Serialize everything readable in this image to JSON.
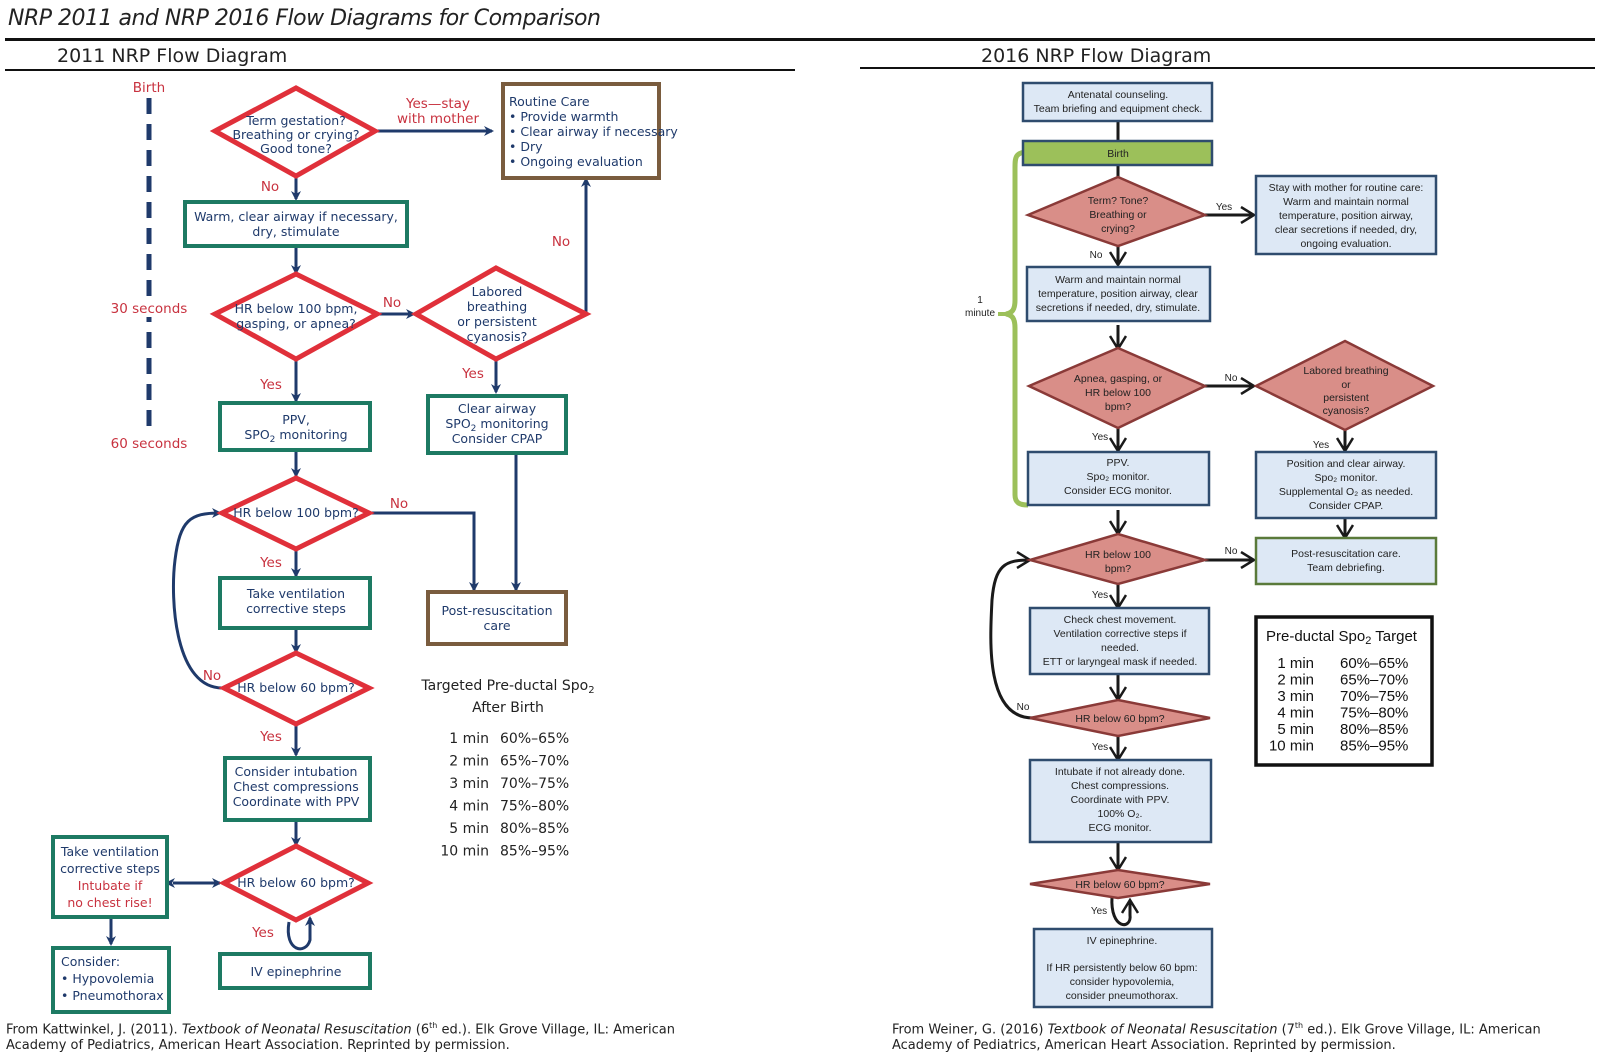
{
  "page": {
    "title": "NRP 2011 and NRP 2016 Flow Diagrams for Comparison"
  },
  "colors": {
    "navy": "#1f3a6b",
    "red": "#e0303a",
    "teal": "#1d7a63",
    "brown": "#7a5c3e",
    "pink": "#d98e88",
    "lightblue": "#dde8f5",
    "green": "#9cc05a",
    "darkline": "#1a1a1a"
  },
  "diagram2011": {
    "title": "2011 NRP Flow Diagram",
    "timeline": {
      "birth": "Birth",
      "t30": "30 seconds",
      "t60": "60 seconds"
    },
    "d_term": [
      "Term gestation?",
      "Breathing or crying?",
      "Good tone?"
    ],
    "yes_stay": [
      "Yes—stay",
      "with mother"
    ],
    "routine": [
      "Routine Care",
      "• Provide warmth",
      "• Clear airway if necessary",
      "• Dry",
      "• Ongoing evaluation"
    ],
    "no": "No",
    "yes": "Yes",
    "warm": [
      "Warm, clear airway if necessary,",
      "dry, stimulate"
    ],
    "d_hr100_gasp": [
      "HR below 100 bpm,",
      "gasping, or apnea?"
    ],
    "d_labored": [
      "Labored",
      "breathing",
      "or persistent",
      "cyanosis?"
    ],
    "ppv": [
      "PPV,",
      "SPO",
      "2",
      " monitoring"
    ],
    "clear_airway": [
      "Clear airway",
      "SPO",
      "2",
      " monitoring",
      "Consider CPAP"
    ],
    "d_hr100": "HR below 100 bpm?",
    "post_resus": [
      "Post-resuscitation",
      "care"
    ],
    "vent_steps": [
      "Take ventilation",
      "corrective steps"
    ],
    "d_hr60a": "HR below 60 bpm?",
    "intubation": [
      "Consider intubation",
      "Chest compressions",
      "Coordinate with PPV"
    ],
    "d_hr60b": "HR below 60 bpm?",
    "vent_intubate": [
      "Take ventilation",
      "corrective steps",
      "Intubate if",
      "no chest rise!"
    ],
    "consider": [
      "Consider:",
      "• Hypovolemia",
      "• Pneumothorax"
    ],
    "epi": "IV epinephrine",
    "spo2_table": {
      "title": [
        "Targeted Pre-ductal Spo",
        "2",
        "After Birth"
      ],
      "rows": [
        {
          "time": "1 min",
          "range": "60%–65%"
        },
        {
          "time": "2 min",
          "range": "65%–70%"
        },
        {
          "time": "3 min",
          "range": "70%–75%"
        },
        {
          "time": "4 min",
          "range": "75%–80%"
        },
        {
          "time": "5 min",
          "range": "80%–85%"
        },
        {
          "time": "10 min",
          "range": "85%–95%"
        }
      ]
    },
    "citation": {
      "pre": "From Kattwinkel, J. (2011). ",
      "book": "Textbook of Neonatal Resuscitation",
      "ed_pre": " (6",
      "ed_sup": "th",
      "post": " ed.). Elk Grove Village, IL: American Academy of Pediatrics, American Heart Association. Reprinted by permission."
    }
  },
  "diagram2016": {
    "title": "2016 NRP Flow Diagram",
    "antenatal": [
      "Antenatal counseling.",
      "Team briefing and equipment check."
    ],
    "birth": "Birth",
    "one_minute": [
      "1",
      "minute"
    ],
    "d_term": [
      "Term? Tone?",
      "Breathing or",
      "crying?"
    ],
    "yes": "Yes",
    "no": "No",
    "stay_mother": [
      "Stay with mother for routine care:",
      "Warm and maintain normal",
      "temperature, position airway,",
      "clear secretions if needed, dry,",
      "ongoing evaluation."
    ],
    "warm": [
      "Warm and maintain normal",
      "temperature, position airway, clear",
      "secretions if needed, dry, stimulate."
    ],
    "d_apnea": [
      "Apnea, gasping, or",
      "HR below 100",
      "bpm?"
    ],
    "d_labored": [
      "Labored breathing",
      "or",
      "persistent",
      "cyanosis?"
    ],
    "ppv": [
      "PPV.",
      "Spo₂ monitor.",
      "Consider ECG monitor."
    ],
    "position": [
      "Position and clear airway.",
      "Spo₂ monitor.",
      "Supplemental O₂ as needed.",
      "Consider CPAP."
    ],
    "d_hr100": [
      "HR below 100",
      "bpm?"
    ],
    "post_resus": [
      "Post-resuscitation care.",
      "Team debriefing."
    ],
    "check_chest": [
      "Check chest movement.",
      "Ventilation corrective steps if",
      "needed.",
      "ETT or laryngeal mask if needed."
    ],
    "d_hr60a": "HR below 60 bpm?",
    "intubate": [
      "Intubate if not already done.",
      "Chest compressions.",
      "Coordinate with PPV.",
      "100% O₂.",
      "ECG monitor."
    ],
    "d_hr60b": "HR below 60 bpm?",
    "epi": [
      "IV epinephrine.",
      "",
      "If HR persistently below 60 bpm:",
      "consider hypovolemia,",
      "consider pneumothorax."
    ],
    "spo2_table": {
      "title": [
        "Pre-ductal ",
        "Spo",
        "2",
        " Target"
      ],
      "rows": [
        {
          "time": "1 min",
          "range": "60%–65%"
        },
        {
          "time": "2 min",
          "range": "65%–70%"
        },
        {
          "time": "3 min",
          "range": "70%–75%"
        },
        {
          "time": "4 min",
          "range": "75%–80%"
        },
        {
          "time": "5 min",
          "range": "80%–85%"
        },
        {
          "time": "10 min",
          "range": "85%–95%"
        }
      ]
    },
    "citation": {
      "pre": "From Weiner, G. (2016) ",
      "book": "Textbook of Neonatal Resuscitation",
      "ed_pre": " (7",
      "ed_sup": "th",
      "post": " ed.). Elk Grove Village, IL: American Academy of Pediatrics, American Heart Association. Reprinted by permission."
    }
  }
}
